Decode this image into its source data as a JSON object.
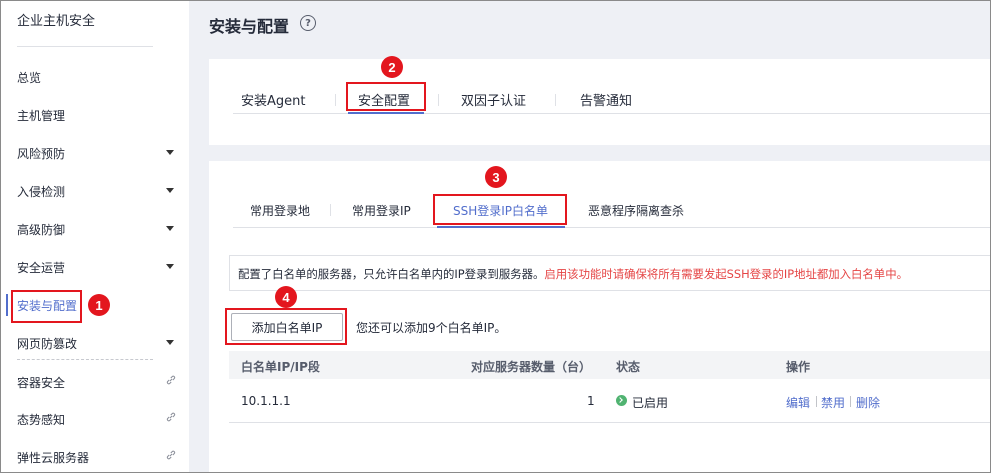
{
  "sidebar": {
    "title": "企业主机安全",
    "items": [
      {
        "label": "总览",
        "caret": false,
        "link": false
      },
      {
        "label": "主机管理",
        "caret": false,
        "link": false
      },
      {
        "label": "风险预防",
        "caret": true,
        "link": false
      },
      {
        "label": "入侵检测",
        "caret": true,
        "link": false
      },
      {
        "label": "高级防御",
        "caret": true,
        "link": false
      },
      {
        "label": "安全运营",
        "caret": true,
        "link": false
      },
      {
        "label": "安装与配置",
        "caret": false,
        "link": false,
        "active": true
      },
      {
        "label": "网页防篡改",
        "caret": true,
        "link": false
      },
      {
        "label": "容器安全",
        "caret": false,
        "link": true
      },
      {
        "label": "态势感知",
        "caret": false,
        "link": true
      },
      {
        "label": "弹性云服务器",
        "caret": false,
        "link": true
      }
    ]
  },
  "header": {
    "title": "安装与配置",
    "help_icon": "question-circle-icon"
  },
  "tabs": [
    {
      "label": "安装Agent"
    },
    {
      "label": "安全配置",
      "active": true
    },
    {
      "label": "双因子认证"
    },
    {
      "label": "告警通知"
    }
  ],
  "subtabs": [
    {
      "label": "常用登录地"
    },
    {
      "label": "常用登录IP"
    },
    {
      "label": "SSH登录IP白名单",
      "active": true
    },
    {
      "label": "恶意程序隔离查杀"
    }
  ],
  "notice": {
    "text": "配置了白名单的服务器，只允许白名单内的IP登录到服务器。",
    "warning": "启用该功能时请确保将所有需要发起SSH登录的IP地址都加入白名单中。"
  },
  "actions": {
    "add_label": "添加白名单IP",
    "hint": "您还可以添加9个白名单IP。"
  },
  "table": {
    "columns": [
      "白名单IP/IP段",
      "对应服务器数量（台）",
      "状态",
      "操作"
    ],
    "rows": [
      {
        "ip": "10.1.1.1",
        "count": "1",
        "status": "已启用",
        "ops": [
          "编辑",
          "禁用",
          "删除"
        ]
      }
    ]
  },
  "annotations": [
    "1",
    "2",
    "3",
    "4"
  ],
  "colors": {
    "accent": "#526ecc",
    "annotation_red": "#e3161e",
    "status_green": "#50b371",
    "warning_text": "#e54545"
  }
}
